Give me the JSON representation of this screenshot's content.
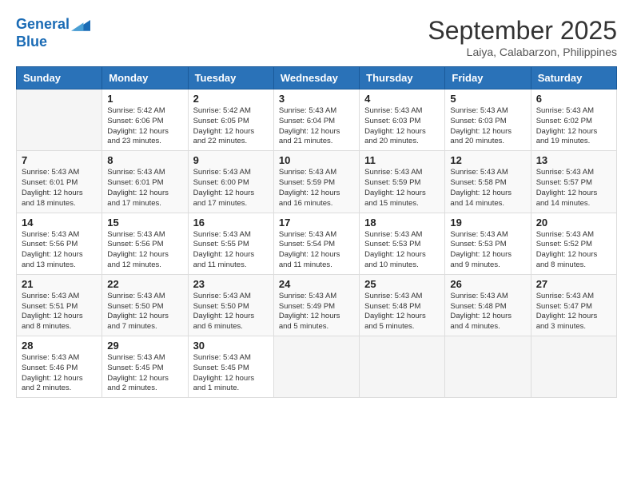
{
  "header": {
    "logo_line1": "General",
    "logo_line2": "Blue",
    "month": "September 2025",
    "location": "Laiya, Calabarzon, Philippines"
  },
  "weekdays": [
    "Sunday",
    "Monday",
    "Tuesday",
    "Wednesday",
    "Thursday",
    "Friday",
    "Saturday"
  ],
  "weeks": [
    [
      {
        "day": "",
        "info": ""
      },
      {
        "day": "1",
        "info": "Sunrise: 5:42 AM\nSunset: 6:06 PM\nDaylight: 12 hours\nand 23 minutes."
      },
      {
        "day": "2",
        "info": "Sunrise: 5:42 AM\nSunset: 6:05 PM\nDaylight: 12 hours\nand 22 minutes."
      },
      {
        "day": "3",
        "info": "Sunrise: 5:43 AM\nSunset: 6:04 PM\nDaylight: 12 hours\nand 21 minutes."
      },
      {
        "day": "4",
        "info": "Sunrise: 5:43 AM\nSunset: 6:03 PM\nDaylight: 12 hours\nand 20 minutes."
      },
      {
        "day": "5",
        "info": "Sunrise: 5:43 AM\nSunset: 6:03 PM\nDaylight: 12 hours\nand 20 minutes."
      },
      {
        "day": "6",
        "info": "Sunrise: 5:43 AM\nSunset: 6:02 PM\nDaylight: 12 hours\nand 19 minutes."
      }
    ],
    [
      {
        "day": "7",
        "info": "Sunrise: 5:43 AM\nSunset: 6:01 PM\nDaylight: 12 hours\nand 18 minutes."
      },
      {
        "day": "8",
        "info": "Sunrise: 5:43 AM\nSunset: 6:01 PM\nDaylight: 12 hours\nand 17 minutes."
      },
      {
        "day": "9",
        "info": "Sunrise: 5:43 AM\nSunset: 6:00 PM\nDaylight: 12 hours\nand 17 minutes."
      },
      {
        "day": "10",
        "info": "Sunrise: 5:43 AM\nSunset: 5:59 PM\nDaylight: 12 hours\nand 16 minutes."
      },
      {
        "day": "11",
        "info": "Sunrise: 5:43 AM\nSunset: 5:59 PM\nDaylight: 12 hours\nand 15 minutes."
      },
      {
        "day": "12",
        "info": "Sunrise: 5:43 AM\nSunset: 5:58 PM\nDaylight: 12 hours\nand 14 minutes."
      },
      {
        "day": "13",
        "info": "Sunrise: 5:43 AM\nSunset: 5:57 PM\nDaylight: 12 hours\nand 14 minutes."
      }
    ],
    [
      {
        "day": "14",
        "info": "Sunrise: 5:43 AM\nSunset: 5:56 PM\nDaylight: 12 hours\nand 13 minutes."
      },
      {
        "day": "15",
        "info": "Sunrise: 5:43 AM\nSunset: 5:56 PM\nDaylight: 12 hours\nand 12 minutes."
      },
      {
        "day": "16",
        "info": "Sunrise: 5:43 AM\nSunset: 5:55 PM\nDaylight: 12 hours\nand 11 minutes."
      },
      {
        "day": "17",
        "info": "Sunrise: 5:43 AM\nSunset: 5:54 PM\nDaylight: 12 hours\nand 11 minutes."
      },
      {
        "day": "18",
        "info": "Sunrise: 5:43 AM\nSunset: 5:53 PM\nDaylight: 12 hours\nand 10 minutes."
      },
      {
        "day": "19",
        "info": "Sunrise: 5:43 AM\nSunset: 5:53 PM\nDaylight: 12 hours\nand 9 minutes."
      },
      {
        "day": "20",
        "info": "Sunrise: 5:43 AM\nSunset: 5:52 PM\nDaylight: 12 hours\nand 8 minutes."
      }
    ],
    [
      {
        "day": "21",
        "info": "Sunrise: 5:43 AM\nSunset: 5:51 PM\nDaylight: 12 hours\nand 8 minutes."
      },
      {
        "day": "22",
        "info": "Sunrise: 5:43 AM\nSunset: 5:50 PM\nDaylight: 12 hours\nand 7 minutes."
      },
      {
        "day": "23",
        "info": "Sunrise: 5:43 AM\nSunset: 5:50 PM\nDaylight: 12 hours\nand 6 minutes."
      },
      {
        "day": "24",
        "info": "Sunrise: 5:43 AM\nSunset: 5:49 PM\nDaylight: 12 hours\nand 5 minutes."
      },
      {
        "day": "25",
        "info": "Sunrise: 5:43 AM\nSunset: 5:48 PM\nDaylight: 12 hours\nand 5 minutes."
      },
      {
        "day": "26",
        "info": "Sunrise: 5:43 AM\nSunset: 5:48 PM\nDaylight: 12 hours\nand 4 minutes."
      },
      {
        "day": "27",
        "info": "Sunrise: 5:43 AM\nSunset: 5:47 PM\nDaylight: 12 hours\nand 3 minutes."
      }
    ],
    [
      {
        "day": "28",
        "info": "Sunrise: 5:43 AM\nSunset: 5:46 PM\nDaylight: 12 hours\nand 2 minutes."
      },
      {
        "day": "29",
        "info": "Sunrise: 5:43 AM\nSunset: 5:45 PM\nDaylight: 12 hours\nand 2 minutes."
      },
      {
        "day": "30",
        "info": "Sunrise: 5:43 AM\nSunset: 5:45 PM\nDaylight: 12 hours\nand 1 minute."
      },
      {
        "day": "",
        "info": ""
      },
      {
        "day": "",
        "info": ""
      },
      {
        "day": "",
        "info": ""
      },
      {
        "day": "",
        "info": ""
      }
    ]
  ]
}
